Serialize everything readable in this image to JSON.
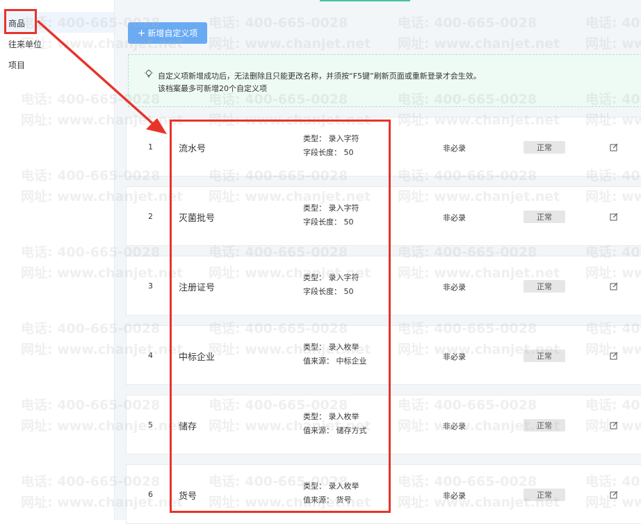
{
  "sidebar": {
    "items": [
      {
        "label": "商品",
        "active": true
      },
      {
        "label": "往来单位",
        "active": false
      },
      {
        "label": "项目",
        "active": false
      }
    ]
  },
  "toolbar": {
    "add_button_label": "新增自定义项",
    "add_icon": "plus-icon"
  },
  "notice": {
    "icon": "lightbulb-icon",
    "line1": "自定义项新增成功后，无法删除且只能更改名称，并须按“F5键”刷新页面或重新登录才会生效。",
    "line2": "该档案最多可新增20个自定义项"
  },
  "rows": [
    {
      "index": "1",
      "name": "流水号",
      "type": "类型： 录入字符",
      "detail": "字段长度： 50",
      "required": "非必录",
      "status": "正常"
    },
    {
      "index": "2",
      "name": "灭菌批号",
      "type": "类型： 录入字符",
      "detail": "字段长度： 50",
      "required": "非必录",
      "status": "正常"
    },
    {
      "index": "3",
      "name": "注册证号",
      "type": "类型： 录入字符",
      "detail": "字段长度： 50",
      "required": "非必录",
      "status": "正常"
    },
    {
      "index": "4",
      "name": "中标企业",
      "type": "类型： 录入枚举",
      "detail": "值来源： 中标企业",
      "required": "非必录",
      "status": "正常"
    },
    {
      "index": "5",
      "name": "储存",
      "type": "类型： 录入枚举",
      "detail": "值来源： 储存方式",
      "required": "非必录",
      "status": "正常"
    },
    {
      "index": "6",
      "name": "货号",
      "type": "类型： 录入枚举",
      "detail": "值来源： 货号",
      "required": "非必录",
      "status": "正常"
    }
  ],
  "watermark": {
    "phone": "电话: 400-665-0028",
    "site": "网址: www.chanjet.net"
  },
  "colors": {
    "accent": "#69aaf3",
    "annotation": "#e8332a",
    "notice_bg": "#eefaf4"
  }
}
